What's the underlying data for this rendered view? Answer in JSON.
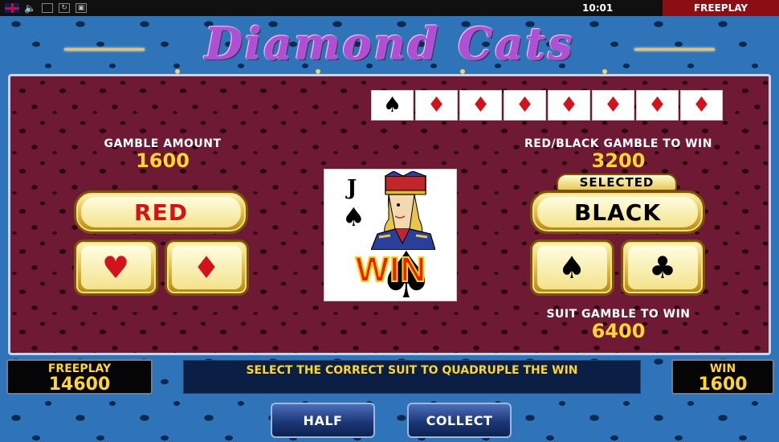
{
  "topbar": {
    "clock": "10:01",
    "mode": "FREEPLAY",
    "icons": [
      "uk-flag-icon",
      "speaker-icon",
      "fullscreen-icon",
      "refresh-icon",
      "settings-icon"
    ]
  },
  "logo": {
    "title": "Diamond Cats"
  },
  "history": [
    {
      "suit": "♠",
      "color": "black"
    },
    {
      "suit": "♦",
      "color": "red"
    },
    {
      "suit": "♦",
      "color": "red"
    },
    {
      "suit": "♦",
      "color": "red"
    },
    {
      "suit": "♦",
      "color": "red"
    },
    {
      "suit": "♦",
      "color": "red"
    },
    {
      "suit": "♦",
      "color": "red"
    },
    {
      "suit": "♦",
      "color": "red"
    }
  ],
  "gamble": {
    "amount_label": "GAMBLE AMOUNT",
    "amount_value": "1600",
    "red_black_label": "RED/BLACK GAMBLE TO WIN",
    "red_black_value": "3200",
    "suit_label": "SUIT GAMBLE TO WIN",
    "suit_value": "6400"
  },
  "buttons": {
    "red": "RED",
    "black": "BLACK",
    "selected_tag": "SELECTED",
    "heart": "♥",
    "diamond": "♦",
    "spade": "♠",
    "club": "♣",
    "half": "HALF",
    "collect": "COLLECT"
  },
  "card": {
    "rank": "J",
    "suit": "♠",
    "result": "WIN"
  },
  "bottom": {
    "freeplay_label": "FREEPLAY",
    "freeplay_value": "14600",
    "message": "SELECT THE CORRECT SUIT TO QUADRUPLE THE WIN",
    "win_label": "WIN",
    "win_value": "1600"
  },
  "colors": {
    "gold": "#ffd531",
    "red": "#d3131c",
    "panel": "#6e1a34",
    "background": "#2f74b8"
  }
}
